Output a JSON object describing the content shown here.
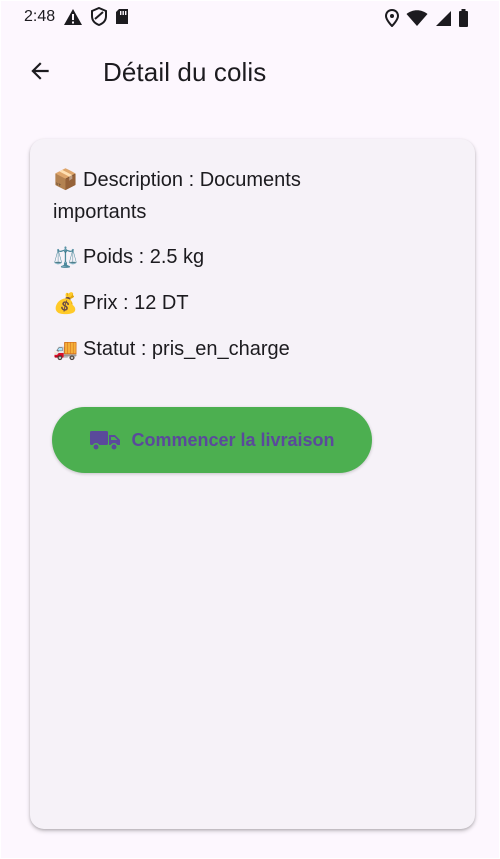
{
  "status_bar": {
    "time": "2:48",
    "left_icons": [
      "warning-icon",
      "shield-icon",
      "sd-card-icon"
    ],
    "right_icons": [
      "location-icon",
      "wifi-icon",
      "cell-signal-icon",
      "battery-icon"
    ]
  },
  "app_bar": {
    "back_icon": "arrow-back-icon",
    "title": "Détail du colis"
  },
  "details": {
    "description_emoji": "📦",
    "description": "Description : Documents importants",
    "weight_emoji": "⚖️",
    "weight": "Poids : 2.5 kg",
    "price_emoji": "💰",
    "price": "Prix : 12 DT",
    "status_emoji": "🚚",
    "status": "Statut : pris_en_charge"
  },
  "action_button": {
    "label": "Commencer la livraison",
    "icon": "truck-icon",
    "background": "#4caf50",
    "text_color": "#5a4a9b"
  }
}
